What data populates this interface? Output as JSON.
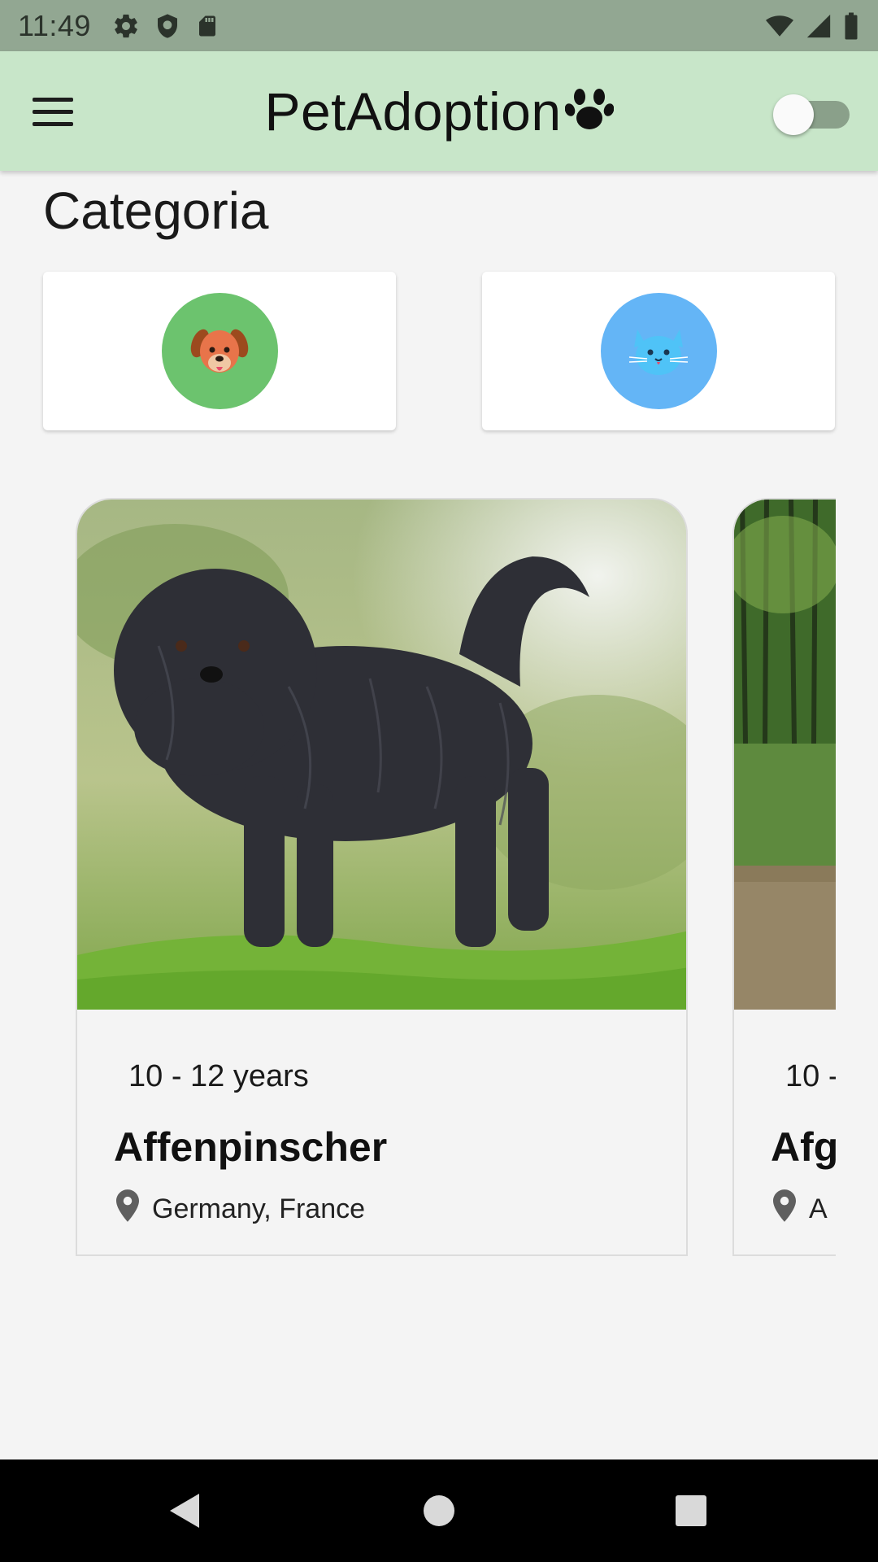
{
  "status_bar": {
    "time": "11:49",
    "icons": [
      "settings-icon",
      "shield-icon",
      "sd-card-icon",
      "wifi-icon",
      "signal-icon",
      "battery-icon"
    ]
  },
  "app_bar": {
    "title": "PetAdoption",
    "menu_icon": "menu-icon",
    "title_icon": "paw-icon",
    "theme_toggle_on": false
  },
  "category": {
    "title": "Categoria",
    "items": [
      {
        "icon": "dog-icon",
        "color": "#6cc36e"
      },
      {
        "icon": "cat-icon",
        "color": "#64b5f6"
      }
    ]
  },
  "pets": [
    {
      "age": "10 - 12 years",
      "name": "Affenpinscher",
      "location": "Germany, France"
    },
    {
      "age": "10 -",
      "name": "Afg",
      "location": "A"
    }
  ],
  "colors": {
    "status_bar": "#92a792",
    "app_bar": "#c8e6c9",
    "background": "#f4f4f4",
    "nav_bar": "#000000"
  },
  "nav_bar": {
    "icons": [
      "back-icon",
      "home-icon",
      "recents-icon"
    ]
  }
}
